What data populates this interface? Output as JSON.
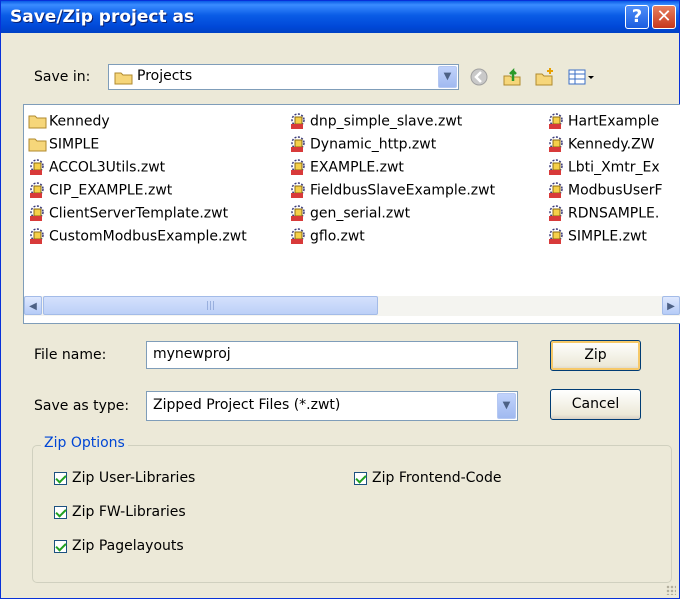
{
  "title": "Save/Zip project as",
  "save_in_label": "Save in:",
  "save_in_value": "Projects",
  "toolbar": {
    "back_icon": "back-arrow-icon",
    "up_icon": "up-folder-icon",
    "new_folder_icon": "new-folder-icon",
    "views_icon": "views-menu-icon"
  },
  "files": [
    {
      "name": "Kennedy",
      "type": "folder"
    },
    {
      "name": "SIMPLE",
      "type": "folder"
    },
    {
      "name": "ACCOL3Utils.zwt",
      "type": "zwt"
    },
    {
      "name": "CIP_EXAMPLE.zwt",
      "type": "zwt"
    },
    {
      "name": "ClientServerTemplate.zwt",
      "type": "zwt"
    },
    {
      "name": "CustomModbusExample.zwt",
      "type": "zwt"
    },
    {
      "name": "dnp_simple_slave.zwt",
      "type": "zwt"
    },
    {
      "name": "Dynamic_http.zwt",
      "type": "zwt"
    },
    {
      "name": "EXAMPLE.zwt",
      "type": "zwt"
    },
    {
      "name": "FieldbusSlaveExample.zwt",
      "type": "zwt"
    },
    {
      "name": "gen_serial.zwt",
      "type": "zwt"
    },
    {
      "name": "gflo.zwt",
      "type": "zwt"
    },
    {
      "name": "HartExample",
      "type": "zwt"
    },
    {
      "name": "Kennedy.ZW",
      "type": "zwt"
    },
    {
      "name": "Lbti_Xmtr_Ex",
      "type": "zwt"
    },
    {
      "name": "ModbusUserF",
      "type": "zwt"
    },
    {
      "name": "RDNSAMPLE.",
      "type": "zwt"
    },
    {
      "name": "SIMPLE.zwt",
      "type": "zwt"
    }
  ],
  "file_name_label": "File name:",
  "file_name_value": "mynewproj",
  "save_type_label": "Save as type:",
  "save_type_value": "Zipped Project Files (*.zwt)",
  "zip_button": "Zip",
  "cancel_button": "Cancel",
  "zip_options": {
    "title": "Zip Options",
    "user_libraries": {
      "label": "Zip User-Libraries",
      "checked": true
    },
    "fw_libraries": {
      "label": "Zip FW-Libraries",
      "checked": true
    },
    "pagelayouts": {
      "label": "Zip Pagelayouts",
      "checked": true
    },
    "frontend_code": {
      "label": "Zip Frontend-Code",
      "checked": true
    }
  }
}
